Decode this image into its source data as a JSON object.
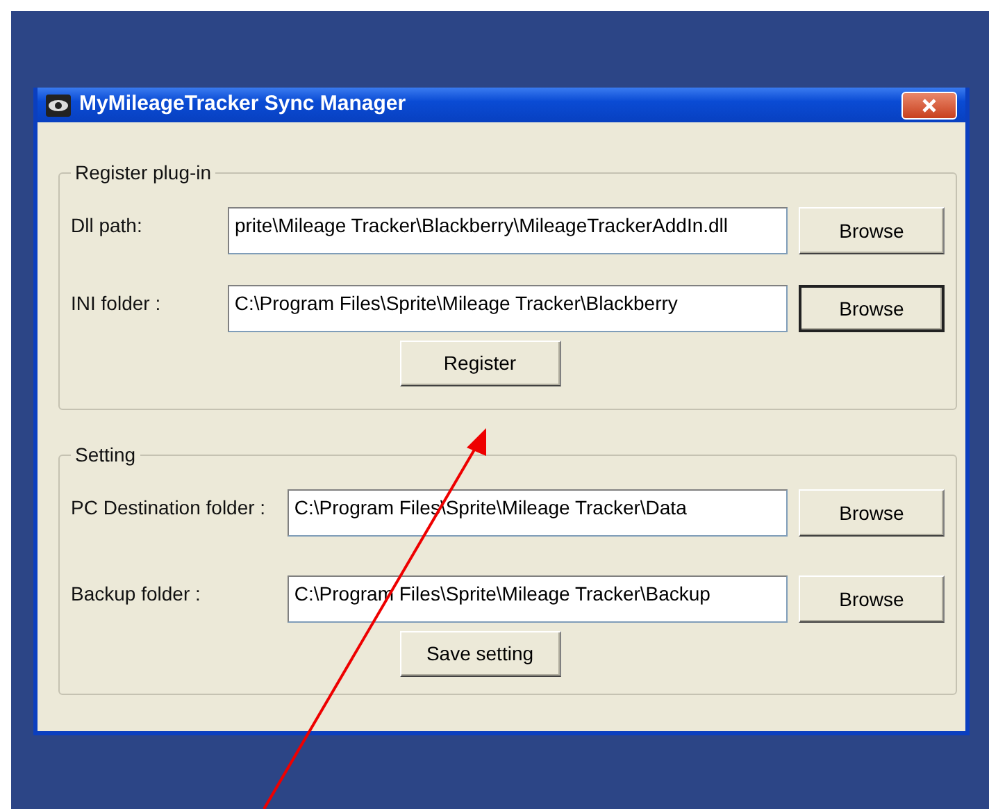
{
  "window": {
    "title": "MyMileageTracker Sync Manager"
  },
  "groups": [
    {
      "title": "Register plug-in",
      "rows": [
        {
          "label": "Dll path:",
          "value": "prite\\Mileage Tracker\\Blackberry\\MileageTrackerAddIn.dll",
          "button": "Browse",
          "focused": false
        },
        {
          "label": "INI folder :",
          "value": "C:\\Program Files\\Sprite\\Mileage Tracker\\Blackberry",
          "button": "Browse",
          "focused": true
        }
      ],
      "action": "Register"
    },
    {
      "title": "Setting",
      "rows": [
        {
          "label": "PC Destination folder :",
          "value": "C:\\Program Files\\Sprite\\Mileage Tracker\\Data",
          "button": "Browse",
          "focused": false
        },
        {
          "label": "Backup folder :",
          "value": "C:\\Program Files\\Sprite\\Mileage Tracker\\Backup",
          "button": "Browse",
          "focused": false
        }
      ],
      "action": "Save setting"
    }
  ]
}
